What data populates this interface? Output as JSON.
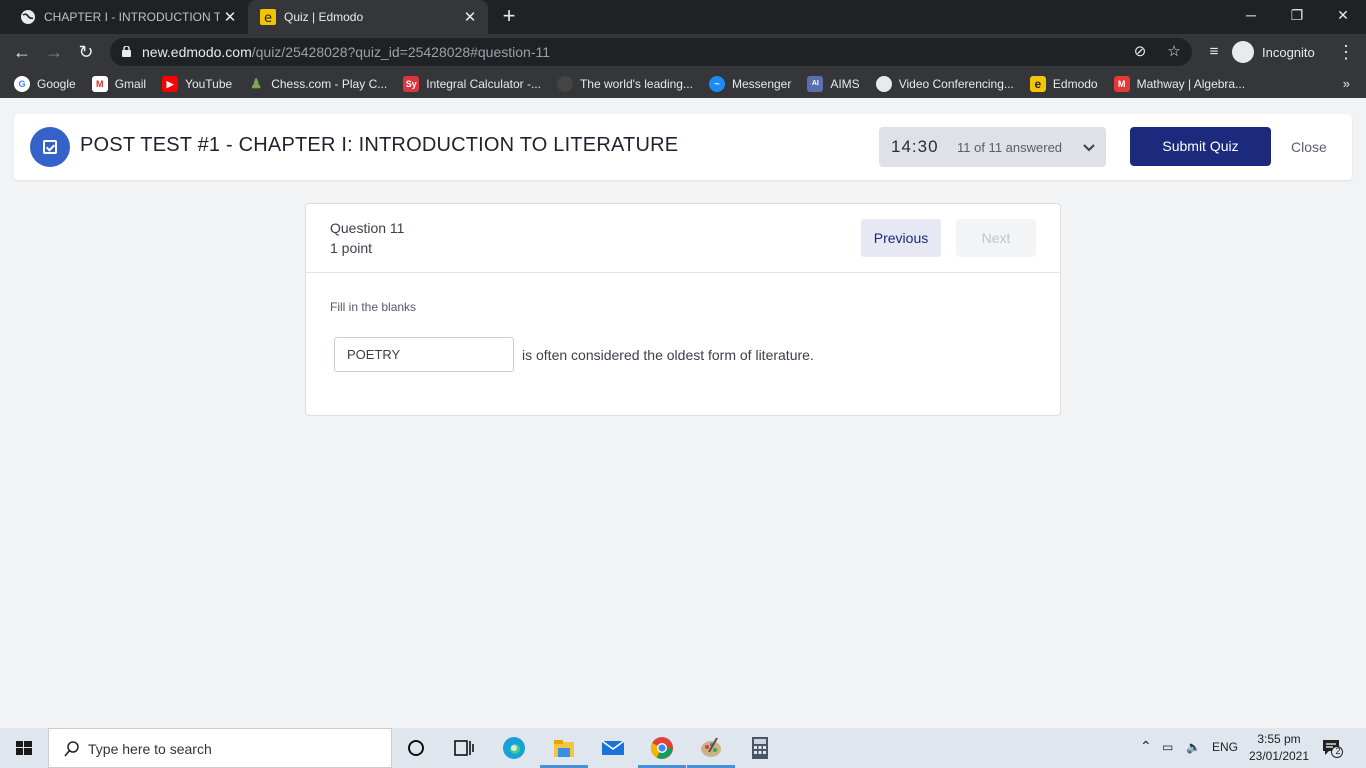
{
  "browser": {
    "tabs": [
      {
        "title": "CHAPTER I - INTRODUCTION TO",
        "active": false
      },
      {
        "title": "Quiz | Edmodo",
        "active": true
      }
    ],
    "new_tab": "+",
    "window_controls": {
      "minimize": "─",
      "restore": "❐",
      "close": "✕"
    },
    "url_host": "new.edmodo.com",
    "url_path": "/quiz/25428028?quiz_id=25428028#question-11",
    "profile_label": "Incognito",
    "bookmarks": [
      {
        "label": "Google",
        "icon": "google-icon",
        "color": "#ffffff"
      },
      {
        "label": "Gmail",
        "icon": "gmail-icon",
        "color": "#d93025"
      },
      {
        "label": "YouTube",
        "icon": "youtube-icon",
        "color": "#ff0000"
      },
      {
        "label": "Chess.com - Play C...",
        "icon": "chess-icon",
        "color": "#7fa650"
      },
      {
        "label": "Integral Calculator -...",
        "icon": "integral-calculator-icon",
        "color": "#d9363e"
      },
      {
        "label": "The world's leading...",
        "icon": "github-icon",
        "color": "#444444"
      },
      {
        "label": "Messenger",
        "icon": "messenger-icon",
        "color": "#1d8cf8"
      },
      {
        "label": "AIMS",
        "icon": "aims-icon",
        "color": "#5a6fb0"
      },
      {
        "label": "Video Conferencing...",
        "icon": "globe-icon",
        "color": "#e8eaed"
      },
      {
        "label": "Edmodo",
        "icon": "edmodo-icon",
        "color": "#f5c400"
      },
      {
        "label": "Mathway | Algebra...",
        "icon": "mathway-icon",
        "color": "#e53935"
      }
    ],
    "bookmarks_more": "»"
  },
  "quiz": {
    "title": "POST TEST #1 - CHAPTER I: INTRODUCTION TO LITERATURE",
    "timer": "14:30",
    "answered": "11 of 11 answered",
    "submit_label": "Submit Quiz",
    "close_label": "Close",
    "accent_color": "#1c2a7e"
  },
  "question": {
    "number_label": "Question 11",
    "points_label": "1 point",
    "previous_label": "Previous",
    "next_label": "Next",
    "instruction": "Fill in the blanks",
    "answer_value": "POETRY",
    "sentence_rest": "is often considered the oldest form of literature."
  },
  "taskbar": {
    "search_placeholder": "Type here to search",
    "language": "ENG",
    "time": "3:55 pm",
    "date": "23/01/2021",
    "notification_count": "2"
  }
}
